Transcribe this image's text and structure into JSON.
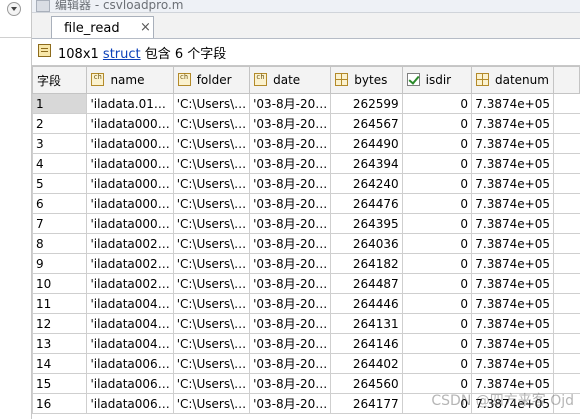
{
  "window": {
    "title": "编辑器 - csvloadpro.m"
  },
  "tab": {
    "label": "file_read",
    "close_glyph": "×"
  },
  "info": {
    "size": "108x1",
    "class_link": "struct",
    "suffix": "包含 6 个字段"
  },
  "table": {
    "corner_label": "字段",
    "columns": [
      {
        "label": "name",
        "icon": "char-icon"
      },
      {
        "label": "folder",
        "icon": "char-icon"
      },
      {
        "label": "date",
        "icon": "char-icon"
      },
      {
        "label": "bytes",
        "icon": "numeric-icon"
      },
      {
        "label": "isdir",
        "icon": "logical-icon"
      },
      {
        "label": "datenum",
        "icon": "numeric-icon"
      }
    ],
    "rows": [
      {
        "idx": "1",
        "name": "'iladata.01…",
        "folder": "'C:\\Users\\…",
        "date": "'03-8月-20…",
        "bytes": "262599",
        "isdir": "0",
        "datenum": "7.3874e+05"
      },
      {
        "idx": "2",
        "name": "'iladata000…",
        "folder": "'C:\\Users\\…",
        "date": "'03-8月-20…",
        "bytes": "264567",
        "isdir": "0",
        "datenum": "7.3874e+05"
      },
      {
        "idx": "3",
        "name": "'iladata000…",
        "folder": "'C:\\Users\\…",
        "date": "'03-8月-20…",
        "bytes": "264490",
        "isdir": "0",
        "datenum": "7.3874e+05"
      },
      {
        "idx": "4",
        "name": "'iladata000…",
        "folder": "'C:\\Users\\…",
        "date": "'03-8月-20…",
        "bytes": "264394",
        "isdir": "0",
        "datenum": "7.3874e+05"
      },
      {
        "idx": "5",
        "name": "'iladata000…",
        "folder": "'C:\\Users\\…",
        "date": "'03-8月-20…",
        "bytes": "264240",
        "isdir": "0",
        "datenum": "7.3874e+05"
      },
      {
        "idx": "6",
        "name": "'iladata000…",
        "folder": "'C:\\Users\\…",
        "date": "'03-8月-20…",
        "bytes": "264476",
        "isdir": "0",
        "datenum": "7.3874e+05"
      },
      {
        "idx": "7",
        "name": "'iladata000…",
        "folder": "'C:\\Users\\…",
        "date": "'03-8月-20…",
        "bytes": "264395",
        "isdir": "0",
        "datenum": "7.3874e+05"
      },
      {
        "idx": "8",
        "name": "'iladata002…",
        "folder": "'C:\\Users\\…",
        "date": "'03-8月-20…",
        "bytes": "264036",
        "isdir": "0",
        "datenum": "7.3874e+05"
      },
      {
        "idx": "9",
        "name": "'iladata002…",
        "folder": "'C:\\Users\\…",
        "date": "'03-8月-20…",
        "bytes": "264182",
        "isdir": "0",
        "datenum": "7.3874e+05"
      },
      {
        "idx": "10",
        "name": "'iladata002…",
        "folder": "'C:\\Users\\…",
        "date": "'03-8月-20…",
        "bytes": "264487",
        "isdir": "0",
        "datenum": "7.3874e+05"
      },
      {
        "idx": "11",
        "name": "'iladata004…",
        "folder": "'C:\\Users\\…",
        "date": "'03-8月-20…",
        "bytes": "264446",
        "isdir": "0",
        "datenum": "7.3874e+05"
      },
      {
        "idx": "12",
        "name": "'iladata004…",
        "folder": "'C:\\Users\\…",
        "date": "'03-8月-20…",
        "bytes": "264131",
        "isdir": "0",
        "datenum": "7.3874e+05"
      },
      {
        "idx": "13",
        "name": "'iladata004…",
        "folder": "'C:\\Users\\…",
        "date": "'03-8月-20…",
        "bytes": "264146",
        "isdir": "0",
        "datenum": "7.3874e+05"
      },
      {
        "idx": "14",
        "name": "'iladata006…",
        "folder": "'C:\\Users\\…",
        "date": "'03-8月-20…",
        "bytes": "264402",
        "isdir": "0",
        "datenum": "7.3874e+05"
      },
      {
        "idx": "15",
        "name": "'iladata006…",
        "folder": "'C:\\Users\\…",
        "date": "'03-8月-20…",
        "bytes": "264560",
        "isdir": "0",
        "datenum": "7.3874e+05"
      },
      {
        "idx": "16",
        "name": "'iladata006…",
        "folder": "'C:\\Users\\…",
        "date": "'03-8月-20…",
        "bytes": "264177",
        "isdir": "0",
        "datenum": "7.3874e+05"
      }
    ]
  },
  "watermark": "CSDN @四方来客 Ojd"
}
